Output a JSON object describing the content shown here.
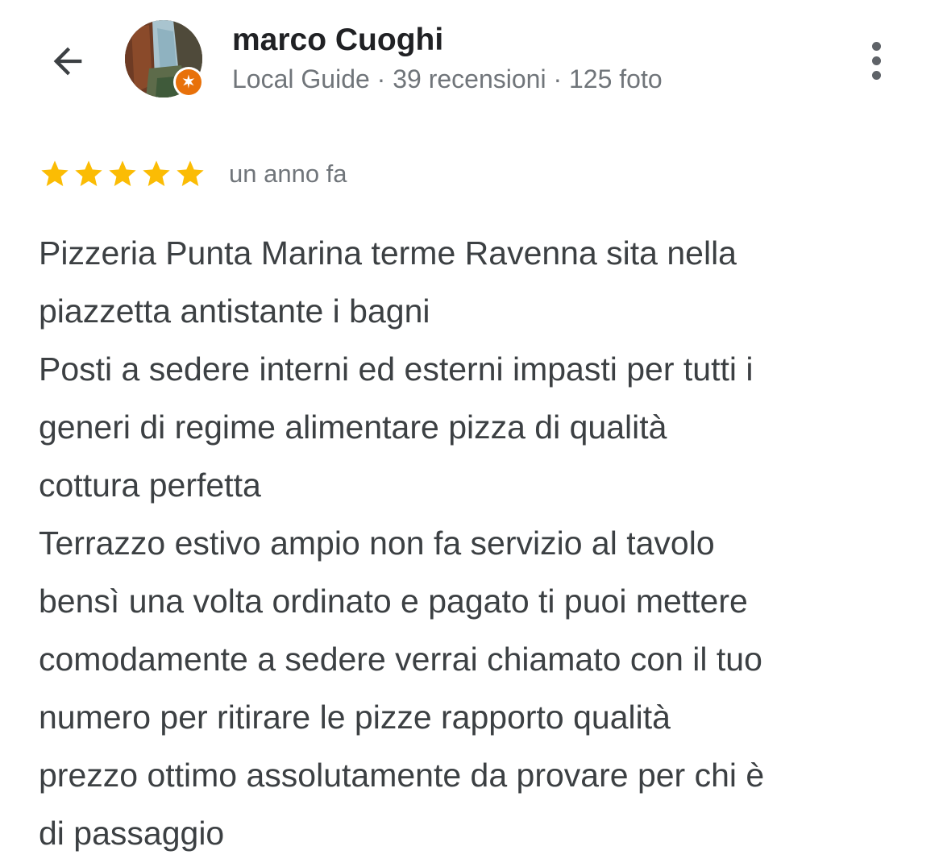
{
  "header": {
    "back_icon": "arrow-back-icon",
    "user_name": "marco Cuoghi",
    "user_meta": "Local Guide · 39 recensioni · 125 foto",
    "badge_icon": "local-guide-star-icon",
    "more_icon": "more-vertical-icon"
  },
  "review": {
    "rating": 5,
    "rating_max": 5,
    "star_color": "#fbbc04",
    "date": "un anno fa",
    "lines": [
      "Pizzeria Punta Marina terme Ravenna sita nella",
      "piazzetta antistante i bagni",
      "Posti a sedere interni ed esterni impasti per tutti i",
      "generi di regime alimentare pizza di qualità",
      "cottura perfetta",
      "Terrazzo estivo ampio non fa servizio al tavolo",
      "bensì una volta ordinato e pagato ti puoi mettere",
      "comodamente a sedere verrai chiamato con il tuo",
      "numero per ritirare le pizze rapporto qualità",
      "prezzo ottimo assolutamente da provare per chi è",
      "di passaggio"
    ]
  },
  "colors": {
    "badge": "#e8710a",
    "text": "#3c4043",
    "meta": "#70757a"
  }
}
